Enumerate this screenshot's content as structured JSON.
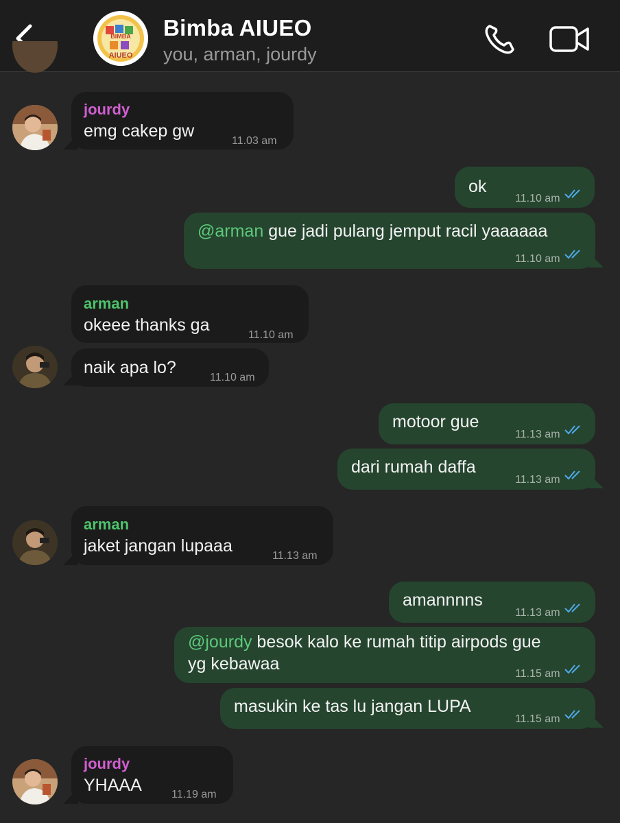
{
  "header": {
    "title": "Bimba AIUEO",
    "subtitle": "you, arman, jourdy",
    "logo_text": "AIUEO",
    "logo_small": "BIMBA"
  },
  "colors": {
    "background": "#262626",
    "incoming_bubble": "#1b1b1b",
    "outgoing_bubble": "#25452f",
    "jourdy_name": "#d05fd0",
    "arman_name": "#4ec46c",
    "read_ticks": "#4fa9e8"
  },
  "messages": [
    {
      "direction": "in",
      "sender": "jourdy",
      "text": "emg cakep gw",
      "time": "11.03 am"
    },
    {
      "direction": "out",
      "text": "ok",
      "time": "11.10 am",
      "status": "read"
    },
    {
      "direction": "out",
      "mention": "@arman",
      "text": " gue jadi pulang jemput racil yaaaaaa",
      "time": "11.10 am",
      "status": "read"
    },
    {
      "direction": "in",
      "sender": "arman",
      "text": "okeee thanks ga",
      "time": "11.10 am"
    },
    {
      "direction": "in",
      "text": "naik apa lo?",
      "time": "11.10 am"
    },
    {
      "direction": "out",
      "text": "motoor gue",
      "time": "11.13 am",
      "status": "read"
    },
    {
      "direction": "out",
      "text": "dari rumah daffa",
      "time": "11.13 am",
      "status": "read"
    },
    {
      "direction": "in",
      "sender": "arman",
      "text": "jaket jangan lupaaa",
      "time": "11.13 am"
    },
    {
      "direction": "out",
      "text": "amannnns",
      "time": "11.13 am",
      "status": "read"
    },
    {
      "direction": "out",
      "mention": "@jourdy",
      "text": " besok kalo ke rumah titip airpods gue",
      "text_line2": "yg kebawaa",
      "time": "11.15 am",
      "status": "read"
    },
    {
      "direction": "out",
      "text": "masukin ke tas lu jangan LUPA",
      "time": "11.15 am",
      "status": "read"
    },
    {
      "direction": "in",
      "sender": "jourdy",
      "text": "YHAAA",
      "time": "11.19 am"
    }
  ]
}
